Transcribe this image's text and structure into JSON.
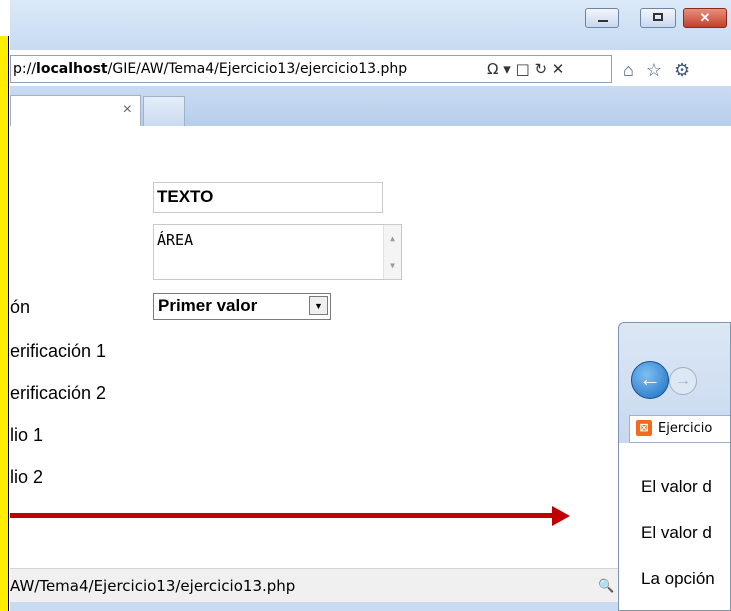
{
  "browser": {
    "address_prefix": "p://",
    "address_host": "localhost",
    "address_path": "/GIE/AW/Tema4/Ejercicio13/ejercicio13.php",
    "address_tools": "Ω ▾ □ ↻ ✕",
    "tab_close": "×",
    "status_url": "AW/Tema4/Ejercicio13/ejercicio13.php"
  },
  "form": {
    "text_value": "TEXTO",
    "area_value": "ÁREA",
    "select_value": "Primer valor",
    "labels": [
      "ón",
      "erificación 1",
      "erificación 2",
      "lio 1",
      "lio 2"
    ]
  },
  "second_window": {
    "tab_label": "Ejercicio",
    "lines": [
      "El valor d",
      "El valor d",
      "La opción"
    ]
  },
  "colors": {
    "highlight_bar": "#ffee00",
    "arrow": "#c00000"
  }
}
